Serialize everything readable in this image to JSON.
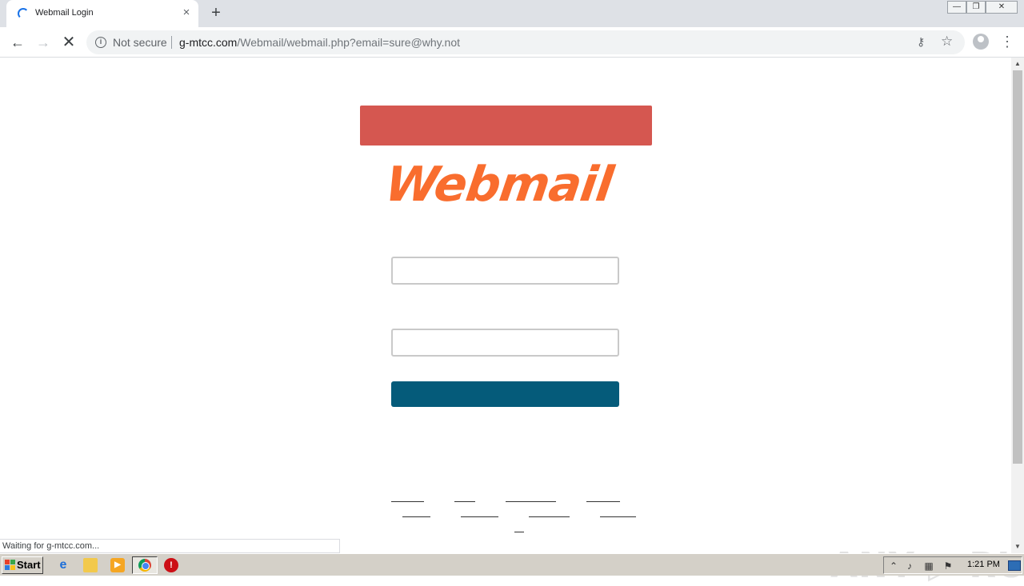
{
  "browser": {
    "tab_title": "Webmail Login",
    "tab_close": "×",
    "new_tab": "+",
    "window_controls": {
      "minimize": "—",
      "maximize": "❐",
      "close": "✕"
    },
    "nav": {
      "back": "←",
      "forward": "→",
      "stop": "✕"
    },
    "address_bar": {
      "security_label": "Not secure",
      "host": "g-mtcc.com",
      "path": "/Webmail/webmail.php?email=sure@why.not"
    },
    "menu": "⋮",
    "status_text": "Waiting for g-mtcc.com..."
  },
  "page": {
    "logo_text": "Webmail",
    "username_value": "",
    "password_value": "",
    "colors": {
      "banner": "#d55750",
      "logo": "#f96d2e",
      "login_button": "#055b7a"
    }
  },
  "watermark": "ANY ▷ RUN",
  "taskbar": {
    "start_label": "Start",
    "clock": "1:21 PM"
  }
}
